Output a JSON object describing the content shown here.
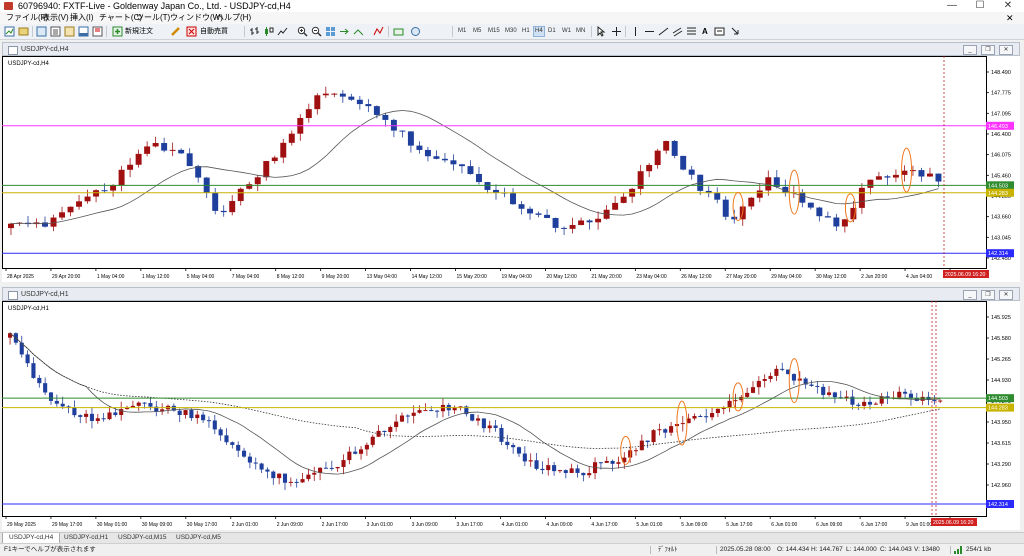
{
  "window": {
    "title": "60796940: FXTF-Live - Goldenway Japan Co., Ltd. - USDJPY-cd,H4",
    "minimize": "—",
    "maximize": "☐",
    "close": "✕"
  },
  "menu": [
    "ファイル(F)",
    "表示(V)",
    "挿入(I)",
    "チャート(C)",
    "ツール(T)",
    "ウィンドウ(W)",
    "ヘルプ(H)"
  ],
  "toolbar": {
    "new_order": "新規注文",
    "auto_trade": "自動売買",
    "timeframes": [
      "M1",
      "M5",
      "M15",
      "M30",
      "H1",
      "H4",
      "D1",
      "W1",
      "MN"
    ],
    "active_timeframe": "H4"
  },
  "chart_h4": {
    "window_title": "USDJPY-cd,H4",
    "symbol_label": "USDJPY-cd,H4",
    "price_ticks": [
      "148.490",
      "147.775",
      "147.095",
      "146.400",
      "146.075",
      "145.460",
      "144.860",
      "143.660",
      "143.045",
      "142.450"
    ],
    "label_pink": "146.493",
    "label_green": "144.503",
    "label_olive": "144.283",
    "label_blue": "142.314",
    "time_ticks": [
      "28 Apr 2025",
      "29 Apr 20:00",
      "1 May 04:00",
      "1 May 12:00",
      "5 May 04:00",
      "7 May 04:00",
      "8 May 12:00",
      "9 May 20:00",
      "13 May 04:00",
      "14 May 12:00",
      "15 May 20:00",
      "19 May 04:00",
      "20 May 12:00",
      "21 May 20:00",
      "23 May 04:00",
      "26 May 12:00",
      "27 May 20:00",
      "29 May 04:00",
      "30 May 12:00",
      "2 Jun 20:00",
      "4 Jun 04:00",
      "5 Jun 12:00"
    ],
    "current_time_label": "2025.06.09 16:20"
  },
  "chart_h1": {
    "window_title": "USDJPY-cd,H1",
    "symbol_label": "USDJPY-cd,H1",
    "price_ticks": [
      "145.925",
      "145.580",
      "145.265",
      "144.930",
      "144.275",
      "143.950",
      "143.615",
      "143.290",
      "142.960",
      "142.625"
    ],
    "label_green": "144.503",
    "label_olive": "144.283",
    "label_blue": "142.314",
    "time_ticks": [
      "29 May 2025",
      "29 May 17:00",
      "30 May 01:00",
      "30 May 09:00",
      "30 May 17:00",
      "2 Jun 01:00",
      "2 Jun 09:00",
      "2 Jun 17:00",
      "3 Jun 01:00",
      "3 Jun 09:00",
      "3 Jun 17:00",
      "4 Jun 01:00",
      "4 Jun 09:00",
      "4 Jun 17:00",
      "5 Jun 01:00",
      "5 Jun 09:00",
      "5 Jun 17:00",
      "6 Jun 01:00",
      "6 Jun 09:00",
      "6 Jun 17:00",
      "9 Jun 01:00",
      "9 Jun 09:00"
    ],
    "current_time_label": "2025.06.09 16:20"
  },
  "tabs": [
    "USDJPY-cd,H4",
    "USDJPY-cd,H1",
    "USDJPY-cd,M15",
    "USDJPY-cd,M5"
  ],
  "active_tab": "USDJPY-cd,H4",
  "status": {
    "help": "F1キーでヘルプが表示されます",
    "profile": "ﾃﾞﾌｫﾙﾄ",
    "datetime": "2025.05.28 08:00",
    "open": "O: 144.434",
    "high": "H: 144.767",
    "low": "L: 144.000",
    "close": "C: 144.043",
    "volume": "V: 13480",
    "traffic": "254/1 kb"
  },
  "colors": {
    "bull": "#a01010",
    "bear": "#1f3f9c",
    "ma": "#555555",
    "pink_line": "#ff33ff",
    "green_line": "#2e8b2e",
    "olive_line": "#c8b400",
    "blue_line": "#2a2aff",
    "pattern_highlight": "#f07820",
    "vline": "#cc2222"
  }
}
